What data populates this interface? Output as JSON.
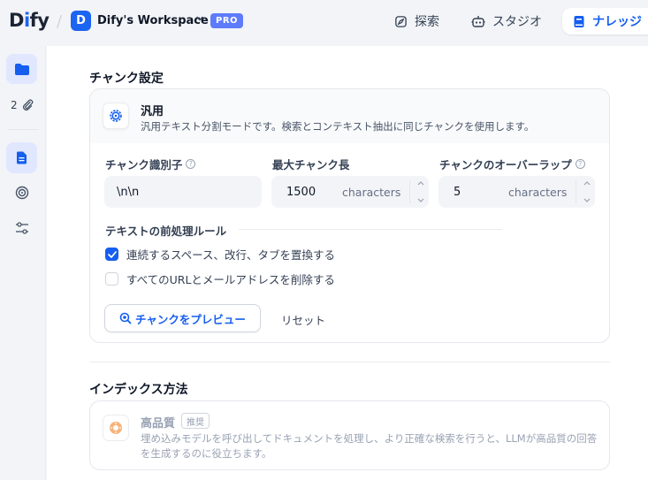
{
  "brand": {
    "logo_pre": "D",
    "logo_i": "i",
    "logo_post": "fy"
  },
  "workspace": {
    "initial": "D",
    "name": "Dify's Workspace",
    "plan_badge": "PRO"
  },
  "nav": {
    "explore": "探索",
    "studio": "スタジオ",
    "knowledge": "ナレッジ"
  },
  "rail": {
    "document_count": "2"
  },
  "chunk_settings": {
    "title": "チャンク設定",
    "mode_name": "汎用",
    "mode_desc": "汎用テキスト分割モードです。検索とコンテキスト抽出に同じチャンクを使用します。",
    "delimiter_label": "チャンク識別子",
    "delimiter_value": "\\n\\n",
    "max_length_label": "最大チャンク長",
    "max_length_value": "1500",
    "max_length_unit": "characters",
    "overlap_label": "チャンクのオーバーラップ",
    "overlap_value": "5",
    "overlap_unit": "characters",
    "help_mark": "?",
    "rules_title": "テキストの前処理ルール",
    "rules": [
      {
        "label": "連続するスペース、改行、タブを置換する",
        "checked": true
      },
      {
        "label": "すべてのURLとメールアドレスを削除する",
        "checked": false
      }
    ],
    "preview_button": "チャンクをプレビュー",
    "reset_button": "リセット"
  },
  "index_method": {
    "title": "インデックス方法",
    "option_name": "高品質",
    "option_badge": "推奨",
    "option_desc": "埋め込みモデルを呼び出してドキュメントを処理し、より正確な検索を行うと、LLMが高品質の回答を生成するのに役立ちます。"
  },
  "colors": {
    "accent": "#155eef",
    "pro_badge": "#5d7bfa",
    "rail_active": "#e0e7ff"
  }
}
